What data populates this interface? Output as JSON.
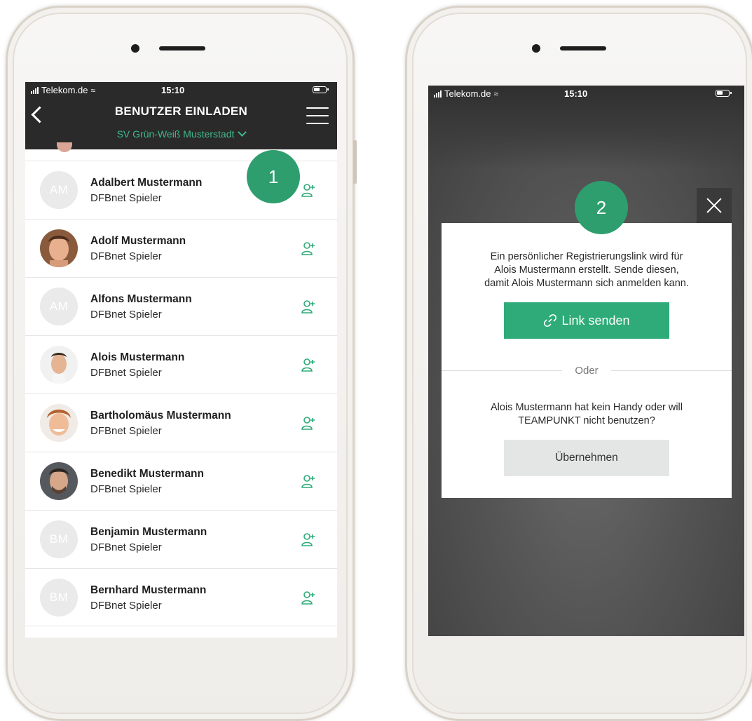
{
  "status_bar": {
    "carrier": "Telekom.de",
    "time": "15:10"
  },
  "left_screen": {
    "title": "BENUTZER EINLADEN",
    "club": "SV Grün-Weiß Musterstadt",
    "users": [
      {
        "name": "Adalbert Mustermann",
        "role": "DFBnet Spieler",
        "avatar": "AM"
      },
      {
        "name": "Adolf Mustermann",
        "role": "DFBnet Spieler",
        "avatar": "photo"
      },
      {
        "name": "Alfons Mustermann",
        "role": "DFBnet Spieler",
        "avatar": "AM"
      },
      {
        "name": "Alois Mustermann",
        "role": "DFBnet Spieler",
        "avatar": "photo"
      },
      {
        "name": "Bartholomäus Mustermann",
        "role": "DFBnet Spieler",
        "avatar": "photo"
      },
      {
        "name": "Benedikt Mustermann",
        "role": "DFBnet Spieler",
        "avatar": "photo"
      },
      {
        "name": "Benjamin Mustermann",
        "role": "DFBnet Spieler",
        "avatar": "BM"
      },
      {
        "name": "Bernhard Mustermann",
        "role": "DFBnet Spieler",
        "avatar": "BM"
      }
    ]
  },
  "badges": {
    "step1": "1",
    "step2": "2"
  },
  "dialog": {
    "line1": "Ein persönlicher Registrierungslink wird für",
    "line2": "Alois Mustermann erstellt. Sende diesen,",
    "line3": "damit Alois Mustermann sich anmelden kann.",
    "link_button": "Link senden",
    "divider": "Oder",
    "line4": "Alois Mustermann hat kein Handy oder will",
    "line5": "TEAMPUNKT nicht benutzen?",
    "take_button": "Übernehmen"
  },
  "colors": {
    "accent": "#2eab78",
    "header": "#2a2a2a",
    "badge": "#2f9e6f",
    "club_text": "#3fb88a"
  },
  "icons": [
    "back-arrow-icon",
    "menu-icon",
    "chevron-down-icon",
    "add-user-icon",
    "close-icon",
    "link-icon",
    "signal-icon",
    "wifi-icon",
    "battery-icon"
  ]
}
